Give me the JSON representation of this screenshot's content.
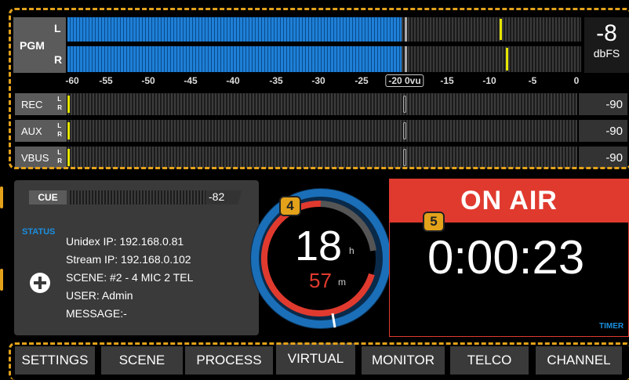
{
  "pgm": {
    "label": "PGM",
    "l": "L",
    "r": "R",
    "level_value": "-8",
    "level_unit": "dbFS",
    "fill_fraction": 0.65
  },
  "scale": {
    "ticks": [
      "-60",
      "-55",
      "-50",
      "-45",
      "-40",
      "-35",
      "-30",
      "-25",
      "-20 0vu",
      "-15",
      "-10",
      "-5",
      "0"
    ]
  },
  "channels": [
    {
      "label": "REC",
      "l": "L",
      "r": "R",
      "value": "-90"
    },
    {
      "label": "AUX",
      "l": "L",
      "r": "R",
      "value": "-90"
    },
    {
      "label": "VBUS",
      "l": "L",
      "r": "R",
      "value": "-90"
    }
  ],
  "cue": {
    "label": "CUE",
    "value": "-82"
  },
  "status": {
    "title": "STATUS",
    "lines": [
      "Unidex IP: 192.168.0.81",
      "Stream IP: 192.168.0.102",
      "SCENE: #2 - 4 MIC 2 TEL",
      "USER: Admin",
      "MESSAGE:-"
    ],
    "add_icon": "plus-circle-icon"
  },
  "clock": {
    "hours": "18",
    "hours_unit": "h",
    "minutes": "57",
    "minutes_unit": "m",
    "badge": "4"
  },
  "onair": {
    "label": "ON AIR",
    "time": "0:00:23",
    "timer_label": "TIMER",
    "badge": "5"
  },
  "tabs": [
    "SETTINGS",
    "SCENE",
    "PROCESS",
    "VIRTUAL",
    "MONITOR",
    "TELCO",
    "CHANNEL"
  ],
  "colors": {
    "accent": "#e3a21a",
    "onair_red": "#e03a2f",
    "meter_blue": "#1e7fd6",
    "status_blue": "#1a8fe0"
  }
}
